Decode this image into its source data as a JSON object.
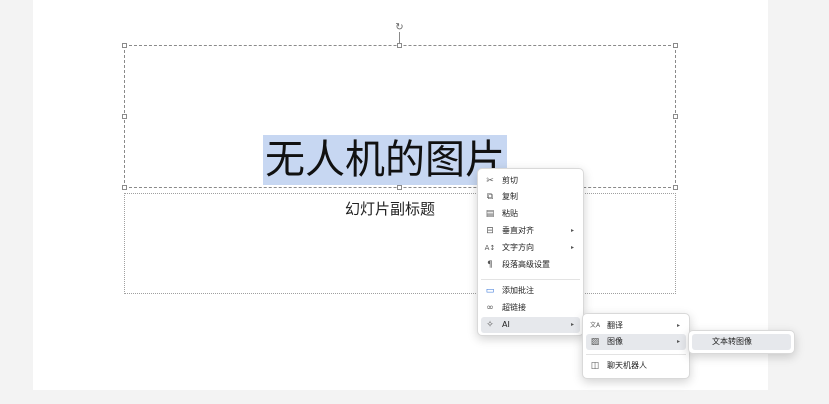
{
  "slide": {
    "title": "无人机的图片",
    "subtitle": "幻灯片副标题"
  },
  "context_menu": {
    "items": [
      {
        "label": "剪切",
        "icon": "scissors-icon",
        "glyph": "✂"
      },
      {
        "label": "复制",
        "icon": "copy-icon",
        "glyph": "⧉"
      },
      {
        "label": "粘贴",
        "icon": "paste-icon",
        "glyph": "▤"
      },
      {
        "label": "垂直对齐",
        "icon": "align-vertical-icon",
        "glyph": "⊟"
      },
      {
        "label": "文字方向",
        "icon": "text-direction-icon",
        "glyph": "A↕"
      },
      {
        "label": "段落高级设置",
        "icon": "paragraph-icon",
        "glyph": "¶"
      },
      {
        "label": "添加批注",
        "icon": "comment-icon",
        "glyph": "▭"
      },
      {
        "label": "超链接",
        "icon": "link-icon",
        "glyph": "∞"
      },
      {
        "label": "AI",
        "icon": "ai-sparkle-icon",
        "glyph": "✧"
      }
    ]
  },
  "ai_submenu": {
    "items": [
      {
        "label": "翻译",
        "icon": "translate-icon",
        "glyph": "文A"
      },
      {
        "label": "图像",
        "icon": "image-icon",
        "glyph": "▨"
      },
      {
        "label": "聊天机器人",
        "icon": "chatbot-icon",
        "glyph": "◫"
      }
    ]
  },
  "image_submenu": {
    "items": [
      {
        "label": "文本转图像"
      }
    ]
  },
  "colors": {
    "selection": "#c7d7f2",
    "hover": "#e6e8ec"
  }
}
